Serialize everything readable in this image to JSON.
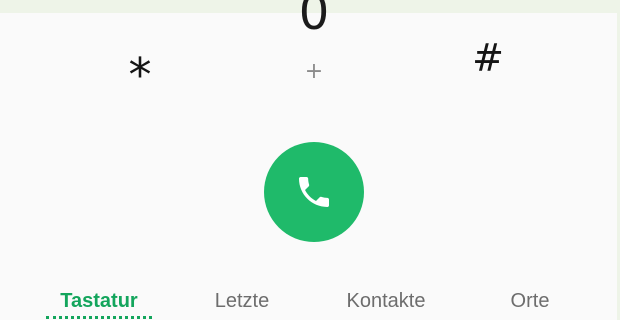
{
  "keypad": {
    "star": "⁎",
    "zero": "0",
    "zero_sub": "+",
    "hash": "#"
  },
  "call": {
    "icon": "phone-icon"
  },
  "tabs": [
    {
      "label": "Tastatur",
      "active": true
    },
    {
      "label": "Letzte",
      "active": false
    },
    {
      "label": "Kontakte",
      "active": false
    },
    {
      "label": "Orte",
      "active": false
    }
  ],
  "colors": {
    "accent": "#13a55c",
    "call_button": "#1fba6a",
    "text_primary": "#1b1b1b",
    "text_secondary": "#6d6d6d",
    "top_strip": "#eef4e8"
  }
}
